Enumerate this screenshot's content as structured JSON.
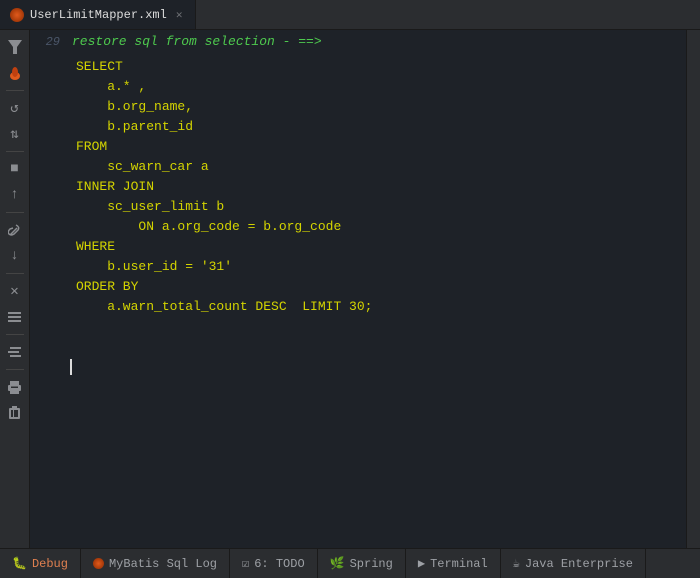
{
  "tab": {
    "title": "UserLimitMapper.xml",
    "icon": "mybatis-icon"
  },
  "toolbar_left": {
    "buttons": [
      {
        "name": "filter-icon",
        "symbol": "⬛",
        "label": "filter"
      },
      {
        "name": "fire-icon",
        "symbol": "🔴",
        "label": "fire",
        "class": "red"
      },
      {
        "name": "refresh-icon",
        "symbol": "↺",
        "label": "refresh"
      },
      {
        "name": "sort-icon",
        "symbol": "⇅",
        "label": "sort"
      },
      {
        "name": "stop-icon",
        "symbol": "■",
        "label": "stop"
      },
      {
        "name": "up-icon",
        "symbol": "↑",
        "label": "up"
      },
      {
        "name": "wrench-icon",
        "symbol": "🔧",
        "label": "wrench"
      },
      {
        "name": "down-icon",
        "symbol": "↓",
        "label": "down"
      },
      {
        "name": "close-icon",
        "symbol": "✕",
        "label": "close"
      },
      {
        "name": "list-icon",
        "symbol": "☰",
        "label": "list"
      },
      {
        "name": "list2-icon",
        "symbol": "≡",
        "label": "list2"
      },
      {
        "name": "print-icon",
        "symbol": "🖨",
        "label": "print"
      },
      {
        "name": "delete-icon",
        "symbol": "🗑",
        "label": "delete"
      }
    ]
  },
  "restore_bar": {
    "line_number": "29",
    "text": "restore sql from selection  - ==>"
  },
  "sql_lines": [
    {
      "num": "",
      "content": "SELECT"
    },
    {
      "num": "",
      "content": "    a.* ,"
    },
    {
      "num": "",
      "content": "    b.org_name,"
    },
    {
      "num": "",
      "content": "    b.parent_id"
    },
    {
      "num": "",
      "content": "FROM"
    },
    {
      "num": "",
      "content": "    sc_warn_car a"
    },
    {
      "num": "",
      "content": "INNER JOIN"
    },
    {
      "num": "",
      "content": "    sc_user_limit b"
    },
    {
      "num": "",
      "content": "        ON a.org_code = b.org_code"
    },
    {
      "num": "",
      "content": "WHERE"
    },
    {
      "num": "",
      "content": "    b.user_id = '31'"
    },
    {
      "num": "",
      "content": "ORDER BY"
    },
    {
      "num": "",
      "content": "    a.warn_total_count DESC  LIMIT 30;"
    }
  ],
  "bottom_bar": {
    "items": [
      {
        "name": "debug-tab",
        "icon": "bug-icon",
        "label": "Debug"
      },
      {
        "name": "mybatis-tab",
        "icon": "mybatis-icon",
        "label": "MyBatis Sql Log"
      },
      {
        "name": "todo-tab",
        "icon": "list-check-icon",
        "label": "6: TODO"
      },
      {
        "name": "spring-tab",
        "icon": "spring-icon",
        "label": "Spring"
      },
      {
        "name": "terminal-tab",
        "icon": "terminal-icon",
        "label": "Terminal"
      },
      {
        "name": "java-enterprise-tab",
        "icon": "java-icon",
        "label": "Java Enterprise"
      }
    ]
  }
}
